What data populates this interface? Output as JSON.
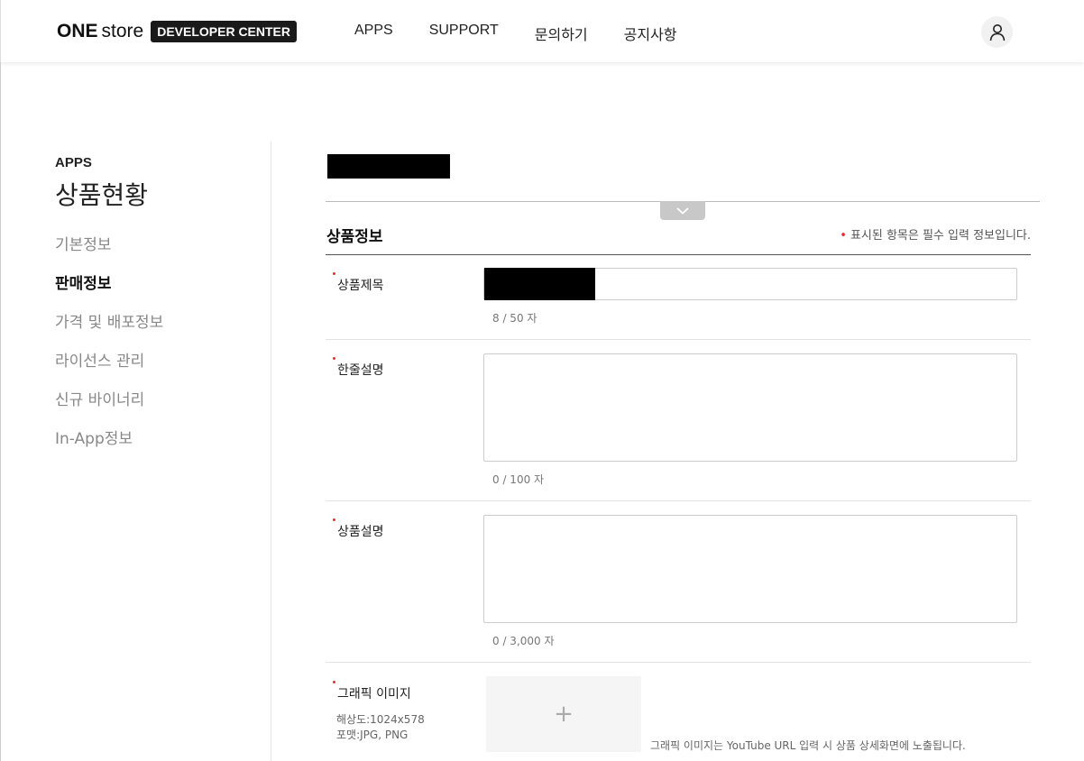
{
  "header": {
    "logo_one": "ONE",
    "logo_store": "store",
    "logo_badge": "DEVELOPER CENTER",
    "nav": [
      "APPS",
      "SUPPORT",
      "문의하기",
      "공지사항"
    ],
    "user_icon": "user-icon"
  },
  "sidebar": {
    "section": "APPS",
    "title": "상품현황",
    "items": [
      {
        "label": "기본정보",
        "active": false
      },
      {
        "label": "판매정보",
        "active": true
      },
      {
        "label": "가격 및 배포정보",
        "active": false
      },
      {
        "label": "라이선스 관리",
        "active": false
      },
      {
        "label": "신규 바이너리",
        "active": false
      },
      {
        "label": "In-App정보",
        "active": false
      }
    ]
  },
  "main": {
    "collapse_icon": "chevron-down-icon",
    "section_title": "상품정보",
    "required_note": "표시된 항목은 필수 입력 정보입니다.",
    "fields": {
      "product_title": {
        "label": "상품제목",
        "counter": "8 / 50 자"
      },
      "one_line_desc": {
        "label": "한줄설명",
        "counter": "0 / 100 자"
      },
      "product_desc": {
        "label": "상품설명",
        "counter": "0 / 3,000 자"
      },
      "graphic_image": {
        "label": "그래픽 이미지",
        "resolution": "해상도:1024x578",
        "format": "포맷:JPG, PNG",
        "add_glyph": "+",
        "note": "그래픽 이미지는 YouTube URL 입력 시 상품 상세화면에 노출됩니다."
      }
    }
  },
  "colors": {
    "required_dot": "#e0312f",
    "badge_bg": "#1a1a1a",
    "muted_text": "#888888"
  }
}
